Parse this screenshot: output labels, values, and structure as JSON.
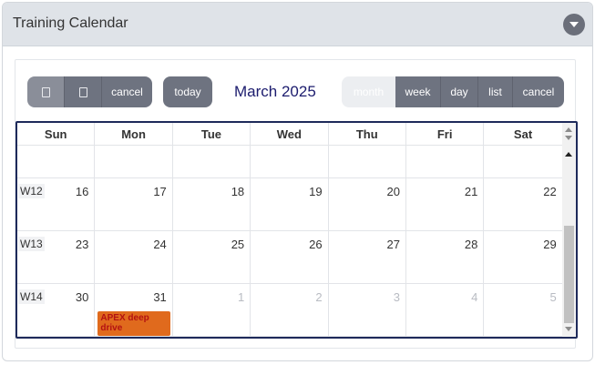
{
  "panel": {
    "title": "Training Calendar"
  },
  "toolbar": {
    "nav_cancel": "cancel",
    "today": "today",
    "title": "March 2025",
    "views": [
      "month",
      "week",
      "day",
      "list",
      "cancel"
    ]
  },
  "calendar": {
    "days_of_week": [
      "Sun",
      "Mon",
      "Tue",
      "Wed",
      "Thu",
      "Fri",
      "Sat"
    ],
    "weeks": [
      {
        "label": "W12",
        "days": [
          "16",
          "17",
          "18",
          "19",
          "20",
          "21",
          "22"
        ]
      },
      {
        "label": "W13",
        "days": [
          "23",
          "24",
          "25",
          "26",
          "27",
          "28",
          "29"
        ]
      },
      {
        "label": "W14",
        "days": [
          "30",
          "31",
          "1",
          "2",
          "3",
          "4",
          "5"
        ]
      }
    ],
    "event": {
      "title": "APEX deep drive",
      "color": "#e06a1d"
    }
  }
}
